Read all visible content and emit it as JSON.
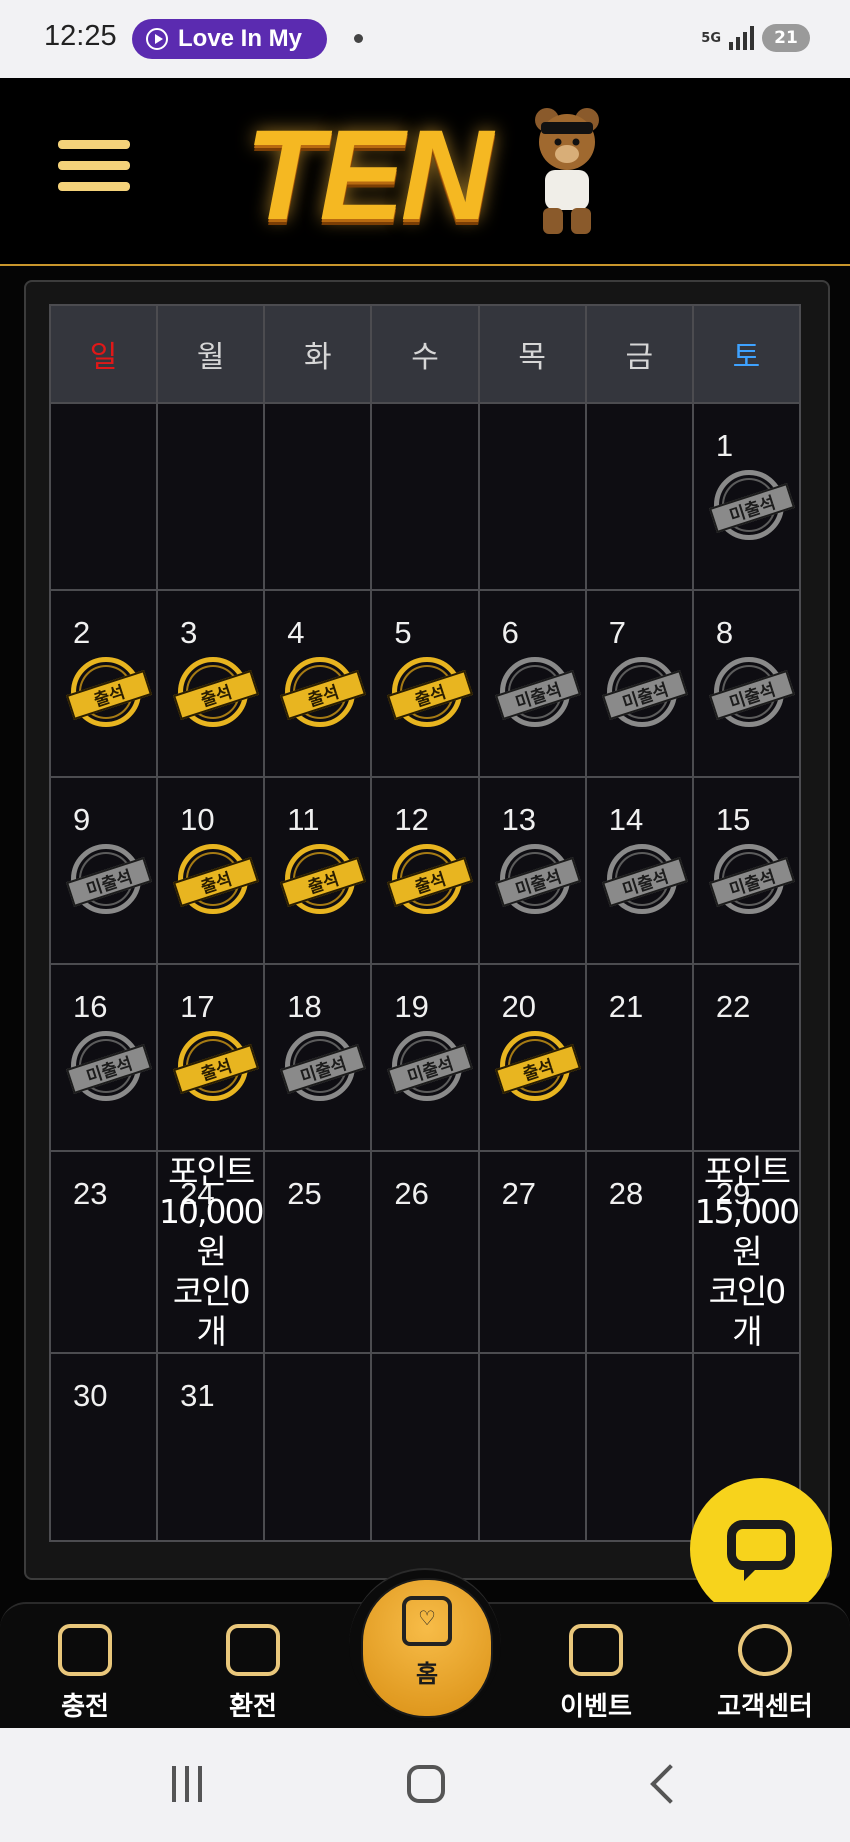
{
  "status_bar": {
    "time": "12:25",
    "media_pill": "Love In My",
    "network": "5G",
    "battery": "21"
  },
  "header": {
    "menu_icon": "hamburger-menu-icon",
    "logo_text": "TEN",
    "logo_icon": "bear-mascot-icon"
  },
  "calendar": {
    "weekdays": [
      "일",
      "월",
      "화",
      "수",
      "목",
      "금",
      "토"
    ],
    "stamp_labels": {
      "attended": "출석",
      "absent": "미출석"
    },
    "weeks": [
      [
        null,
        null,
        null,
        null,
        null,
        null,
        {
          "day": "1",
          "status": "absent"
        }
      ],
      [
        {
          "day": "2",
          "status": "attended"
        },
        {
          "day": "3",
          "status": "attended"
        },
        {
          "day": "4",
          "status": "attended"
        },
        {
          "day": "5",
          "status": "attended"
        },
        {
          "day": "6",
          "status": "absent"
        },
        {
          "day": "7",
          "status": "absent"
        },
        {
          "day": "8",
          "status": "absent"
        }
      ],
      [
        {
          "day": "9",
          "status": "absent"
        },
        {
          "day": "10",
          "status": "attended"
        },
        {
          "day": "11",
          "status": "attended"
        },
        {
          "day": "12",
          "status": "attended"
        },
        {
          "day": "13",
          "status": "absent"
        },
        {
          "day": "14",
          "status": "absent"
        },
        {
          "day": "15",
          "status": "absent"
        }
      ],
      [
        {
          "day": "16",
          "status": "absent"
        },
        {
          "day": "17",
          "status": "attended"
        },
        {
          "day": "18",
          "status": "absent"
        },
        {
          "day": "19",
          "status": "absent"
        },
        {
          "day": "20",
          "status": "attended"
        },
        {
          "day": "21",
          "status": ""
        },
        {
          "day": "22",
          "status": ""
        }
      ],
      [
        {
          "day": "23",
          "status": ""
        },
        {
          "day": "24",
          "status": "",
          "reward": [
            "포인트",
            "10,000",
            "원",
            "코인0",
            "개"
          ]
        },
        {
          "day": "25",
          "status": ""
        },
        {
          "day": "26",
          "status": ""
        },
        {
          "day": "27",
          "status": ""
        },
        {
          "day": "28",
          "status": ""
        },
        {
          "day": "29",
          "status": "",
          "reward": [
            "포인트",
            "15,000",
            "원",
            "코인0",
            "개"
          ]
        }
      ],
      [
        {
          "day": "30",
          "status": ""
        },
        {
          "day": "31",
          "status": ""
        },
        null,
        null,
        null,
        null,
        null
      ]
    ]
  },
  "chat_button": {
    "icon": "chat-bubble-icon"
  },
  "bottom_nav": {
    "items": [
      {
        "label": "충전",
        "icon": "charge-hand-icon"
      },
      {
        "label": "환전",
        "icon": "exchange-hand-icon"
      },
      {
        "label": "홈",
        "icon": "home-heart-icon"
      },
      {
        "label": "이벤트",
        "icon": "gift-icon"
      },
      {
        "label": "고객센터",
        "icon": "support-agent-icon"
      }
    ]
  },
  "system_nav": {
    "recent": "recent-apps-icon",
    "home": "home-circle-icon",
    "back": "back-chevron-icon"
  }
}
